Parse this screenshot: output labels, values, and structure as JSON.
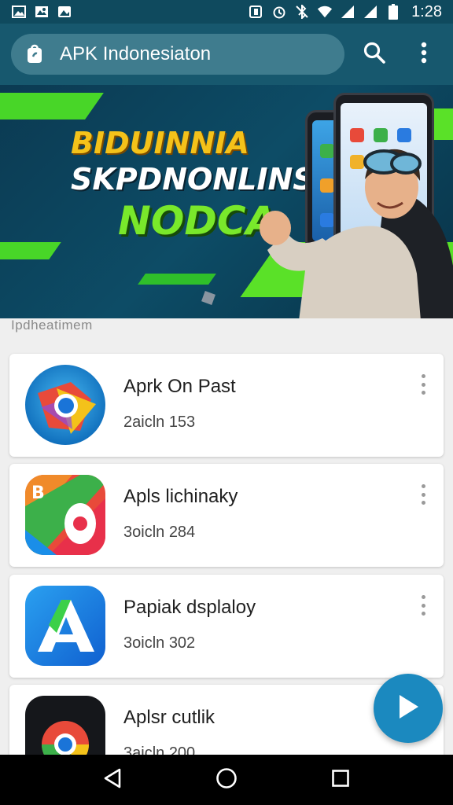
{
  "status_bar": {
    "time": "1:28",
    "left_icons": [
      "image-icon",
      "photo-icon",
      "gallery-icon"
    ],
    "right_icons": [
      "nfc-icon",
      "alarm-icon",
      "bluetooth-off-icon",
      "wifi-icon",
      "signal-icon",
      "signal-icon",
      "battery-icon"
    ]
  },
  "app_bar": {
    "search_text": "APK Indonesiaton",
    "store_icon": "shopping-bag-icon",
    "search_icon": "search-icon",
    "menu_icon": "more-vert-icon",
    "bar_color": "#17586e"
  },
  "banner": {
    "line1": "BIDUINNIA",
    "line2": "SKPDNONLINS",
    "line3": "NODCA"
  },
  "section": {
    "label": "Ipdheatimem"
  },
  "apps": [
    {
      "title": "Aprk On Past",
      "meta": "2aicln 153",
      "icon": "chrome-style-app-icon"
    },
    {
      "title": "Apls lichinaky",
      "meta": "3oicln 284",
      "icon": "maps-style-app-icon"
    },
    {
      "title": "Papiak dsplaloy",
      "meta": "3oicln 302",
      "icon": "letter-a-app-icon"
    },
    {
      "title": "Aplsr cutlik",
      "meta": "3aicln 200",
      "icon": "chrome-dark-app-icon"
    }
  ],
  "fab": {
    "icon": "play-icon",
    "color": "#1b89bf"
  },
  "nav": {
    "back": "back-icon",
    "home": "home-icon",
    "recents": "recents-icon"
  }
}
